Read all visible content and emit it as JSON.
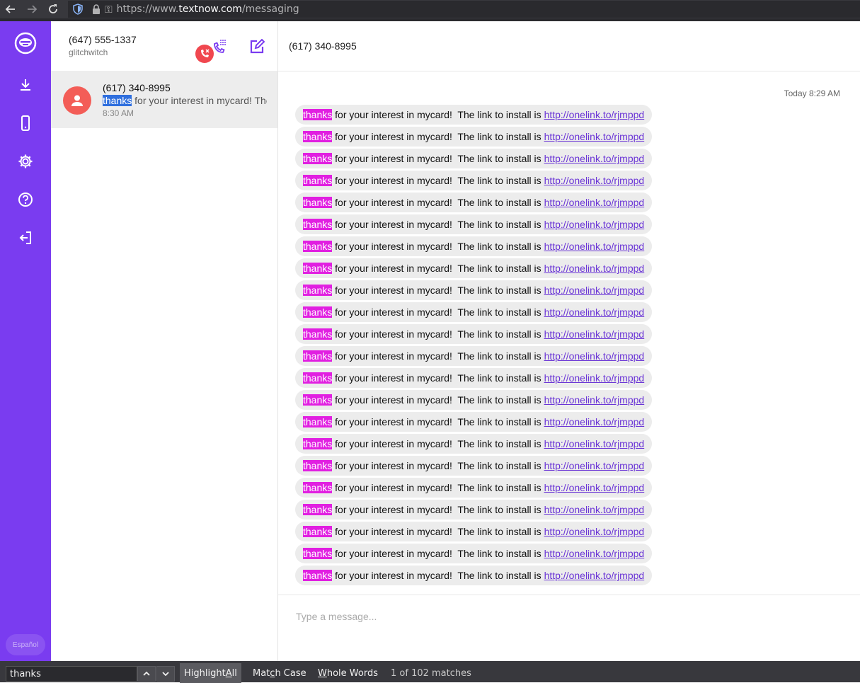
{
  "browser": {
    "url_prefix": "https://www.",
    "url_domain": "textnow.com",
    "url_path": "/messaging"
  },
  "rail": {
    "items": [
      {
        "name": "textnow-logo-icon"
      },
      {
        "name": "download-icon"
      },
      {
        "name": "phone-device-icon"
      },
      {
        "name": "gear-icon"
      },
      {
        "name": "help-icon"
      },
      {
        "name": "logout-icon"
      }
    ],
    "language_label": "Español"
  },
  "account": {
    "phone": "(647) 555-1337",
    "username": "glitchwitch"
  },
  "conversations": [
    {
      "name": "(617) 340-8995",
      "snippet_highlight": "thanks",
      "snippet_rest": " for your interest in mycard!  The link to install is http://onelink.to/rjmppd",
      "time": "8:30 AM"
    }
  ],
  "chat": {
    "title": "(617) 340-8995",
    "timestamp": "Today 8:29 AM",
    "message": {
      "highlight": "thanks",
      "text": " for your interest in mycard!  The link to install is ",
      "link": "http://onelink.to/rjmppd"
    },
    "visible_message_count": 22,
    "composer_placeholder": "Type a message..."
  },
  "findbar": {
    "query": "thanks",
    "highlight_all": {
      "pre": "Highlight ",
      "key": "A",
      "post": "ll"
    },
    "match_case": {
      "pre": "Mat",
      "key": "c",
      "post": "h Case"
    },
    "whole_words": {
      "pre": "",
      "key": "W",
      "post": "hole Words"
    },
    "match_count": "1 of 102 matches"
  }
}
